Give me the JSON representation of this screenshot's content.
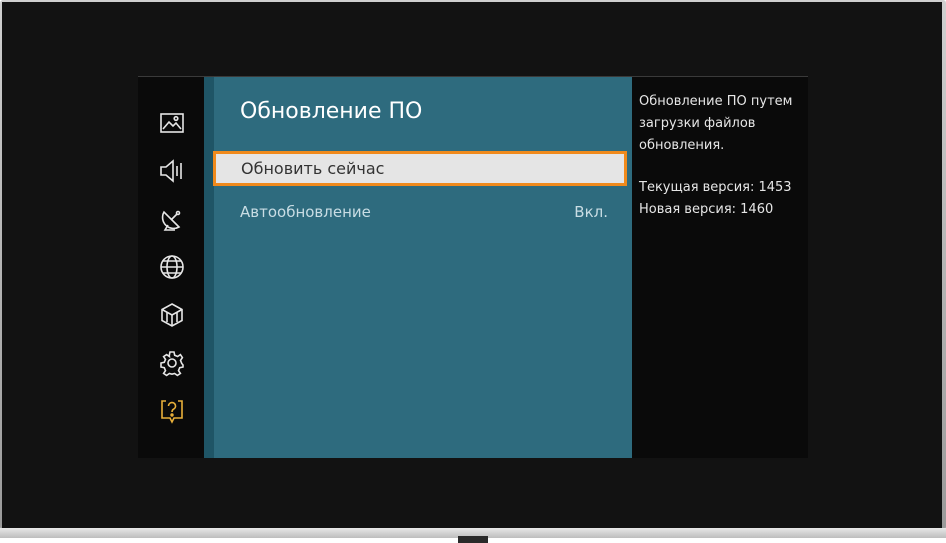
{
  "panel": {
    "title": "Обновление ПО",
    "items": [
      {
        "label": "Обновить сейчас",
        "selected": true
      },
      {
        "label": "Автообновление",
        "value": "Вкл."
      }
    ]
  },
  "info": {
    "description": "Обновление ПО путем загрузки файлов обновления.",
    "current_version": "Текущая версия: 1453",
    "new_version": "Новая версия: 1460"
  },
  "sidebar": {
    "icons": [
      "picture-icon",
      "sound-icon",
      "broadcast-icon",
      "network-icon",
      "system-icon",
      "settings-icon",
      "support-icon"
    ],
    "active": "support-icon"
  },
  "colors": {
    "panel": "#2e6b7e",
    "selection_border": "#f08a1c",
    "support_icon": "#e8b03a"
  }
}
